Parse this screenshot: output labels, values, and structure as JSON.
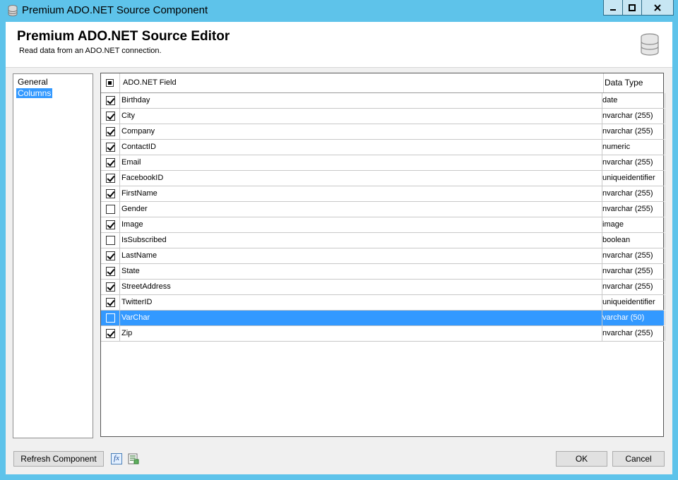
{
  "window": {
    "title": "Premium ADO.NET Source Component",
    "caption_buttons": {
      "minimize": "minimize-icon",
      "maximize": "maximize-icon",
      "close": "close-icon"
    }
  },
  "header": {
    "title": "Premium ADO.NET Source Editor",
    "subtitle": "Read data from an ADO.NET connection.",
    "icon": "database-icon"
  },
  "nav": {
    "items": [
      {
        "label": "General"
      },
      {
        "label": "Columns",
        "selected": true
      }
    ]
  },
  "grid": {
    "columns": {
      "field": "ADO.NET Field",
      "type": "Data Type"
    },
    "rows": [
      {
        "field": "Birthday",
        "type": "date",
        "checked": true
      },
      {
        "field": "City",
        "type": "nvarchar (255)",
        "checked": true
      },
      {
        "field": "Company",
        "type": "nvarchar (255)",
        "checked": true
      },
      {
        "field": "ContactID",
        "type": "numeric",
        "checked": true
      },
      {
        "field": "Email",
        "type": "nvarchar (255)",
        "checked": true
      },
      {
        "field": "FacebookID",
        "type": "uniqueidentifier",
        "checked": true
      },
      {
        "field": "FirstName",
        "type": "nvarchar (255)",
        "checked": true
      },
      {
        "field": "Gender",
        "type": "nvarchar (255)",
        "checked": false
      },
      {
        "field": "Image",
        "type": "image",
        "checked": true
      },
      {
        "field": "IsSubscribed",
        "type": "boolean",
        "checked": false
      },
      {
        "field": "LastName",
        "type": "nvarchar (255)",
        "checked": true
      },
      {
        "field": "State",
        "type": "nvarchar (255)",
        "checked": true
      },
      {
        "field": "StreetAddress",
        "type": "nvarchar (255)",
        "checked": true
      },
      {
        "field": "TwitterID",
        "type": "uniqueidentifier",
        "checked": true
      },
      {
        "field": "VarChar",
        "type": "varchar (50)",
        "checked": false,
        "selected": true
      },
      {
        "field": "Zip",
        "type": "nvarchar (255)",
        "checked": true
      }
    ]
  },
  "footer": {
    "refresh_label": "Refresh Component",
    "fx_icon": "fx-icon",
    "fx_label": "fx",
    "list_icon": "column-list-icon",
    "ok_label": "OK",
    "cancel_label": "Cancel"
  },
  "colors": {
    "title_bar": "#5ec3ea",
    "selection": "#3399ff"
  }
}
